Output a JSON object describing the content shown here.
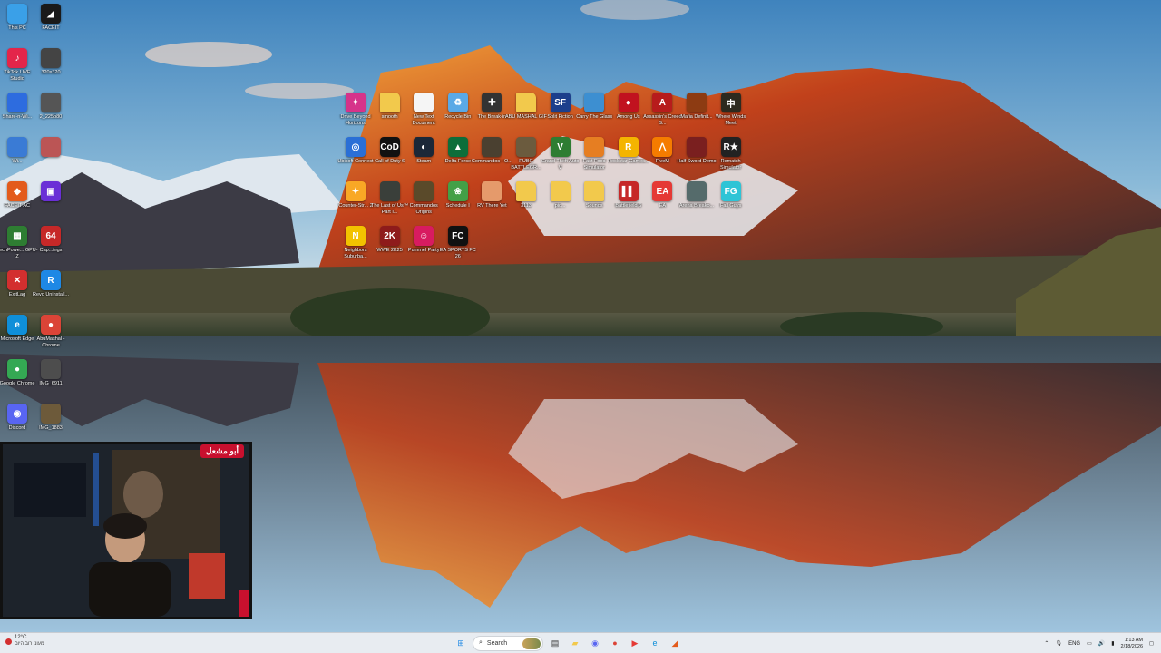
{
  "desktop": {
    "left_column": [
      {
        "label": "This PC",
        "icon": "monitor-icon",
        "color": "#3aa0e8",
        "glyph": ""
      },
      {
        "label": "FACEIT",
        "icon": "faceit-icon",
        "color": "#1a1a1a",
        "glyph": "◢"
      },
      {
        "label": "TikTok LIVE Studio",
        "icon": "tiktok-icon",
        "color": "#e4254a",
        "glyph": "♪"
      },
      {
        "label": "320x320",
        "icon": "image-file-icon",
        "color": "#444",
        "glyph": ""
      },
      {
        "label": "Share-n-Wi...",
        "icon": "app-icon",
        "color": "#2d6cdf",
        "glyph": ""
      },
      {
        "label": "2_225b80",
        "icon": "image-file-icon",
        "color": "#555",
        "glyph": ""
      },
      {
        "label": "Wi...",
        "icon": "app-icon",
        "color": "#3a7bd5",
        "glyph": ""
      },
      {
        "label": "",
        "icon": "image-file-icon",
        "color": "#b55",
        "glyph": ""
      },
      {
        "label": "FACEIT AC",
        "icon": "faceit-ac-icon",
        "color": "#e35b1c",
        "glyph": "◆"
      },
      {
        "label": "",
        "icon": "app-icon",
        "color": "#6a2fd6",
        "glyph": "▣"
      },
      {
        "label": "TechPowe... GPU-Z",
        "icon": "gpuz-icon",
        "color": "#2e7d32",
        "glyph": "▦"
      },
      {
        "label": "Cap...ings",
        "icon": "capframe-icon",
        "color": "#c62828",
        "glyph": "64"
      },
      {
        "label": "ExitLag",
        "icon": "exitlag-icon",
        "color": "#d32f2f",
        "glyph": "✕"
      },
      {
        "label": "Revo Uninstall...",
        "icon": "revo-icon",
        "color": "#1e88e5",
        "glyph": "R"
      },
      {
        "label": "Microsoft Edge",
        "icon": "edge-icon",
        "color": "#0f8fd9",
        "glyph": "e"
      },
      {
        "label": "AbuMashal - Chrome",
        "icon": "chrome-icon",
        "color": "#db4437",
        "glyph": "●"
      },
      {
        "label": "Google Chrome",
        "icon": "chrome-icon",
        "color": "#34a853",
        "glyph": "●"
      },
      {
        "label": "IMG_6911",
        "icon": "image-file-icon",
        "color": "#4d4d4d",
        "glyph": ""
      },
      {
        "label": "Discord",
        "icon": "discord-icon",
        "color": "#5865f2",
        "glyph": "◉"
      },
      {
        "label": "IMG_1883",
        "icon": "image-file-icon",
        "color": "#6d5a3a",
        "glyph": ""
      }
    ],
    "grid": [
      {
        "label": "Drive Beyond Horizons",
        "icon": "game-icon",
        "color": "#d6338a",
        "glyph": "✦"
      },
      {
        "label": "smooth",
        "icon": "folder-icon",
        "color": "#f2c94c",
        "glyph": ""
      },
      {
        "label": "New Text Document",
        "icon": "text-file-icon",
        "color": "#f5f5f5",
        "glyph": ""
      },
      {
        "label": "Recycle Bin",
        "icon": "recycle-bin-icon",
        "color": "#5aa9e6",
        "glyph": "♻"
      },
      {
        "label": "The Break-in",
        "icon": "game-icon",
        "color": "#333",
        "glyph": "✚"
      },
      {
        "label": "ABU MASHAL GIF",
        "icon": "folder-icon",
        "color": "#f2c94c",
        "glyph": ""
      },
      {
        "label": "Split Fiction",
        "icon": "game-icon",
        "color": "#1c3f8c",
        "glyph": "SF"
      },
      {
        "label": "Carry The Glass",
        "icon": "game-icon",
        "color": "#3d8fd1",
        "glyph": ""
      },
      {
        "label": "Among Us",
        "icon": "game-icon",
        "color": "#c1121f",
        "glyph": "●"
      },
      {
        "label": "Assassin's Creed S...",
        "icon": "game-icon",
        "color": "#b71c1c",
        "glyph": "A"
      },
      {
        "label": "Mafia Definit...",
        "icon": "game-icon",
        "color": "#8d3b12",
        "glyph": ""
      },
      {
        "label": "Where Winds Meet",
        "icon": "game-icon",
        "color": "#2d2a1f",
        "glyph": "中"
      },
      {
        "label": "Ubisoft Connect",
        "icon": "ubisoft-icon",
        "color": "#2a6fd6",
        "glyph": "◎"
      },
      {
        "label": "Call of Duty 6",
        "icon": "game-icon",
        "color": "#111",
        "glyph": "CoD"
      },
      {
        "label": "Steam",
        "icon": "steam-icon",
        "color": "#1b2838",
        "glyph": "◐"
      },
      {
        "label": "Delta Force",
        "icon": "game-icon",
        "color": "#0d6e3a",
        "glyph": "▲"
      },
      {
        "label": "Commandos - O...",
        "icon": "game-icon",
        "color": "#4a4030",
        "glyph": ""
      },
      {
        "label": "PUBG BATTLEGR...",
        "icon": "game-icon",
        "color": "#6b5b3e",
        "glyph": ""
      },
      {
        "label": "Grand Theft Auto V",
        "icon": "game-icon",
        "color": "#2e7d32",
        "glyph": "V"
      },
      {
        "label": "Fast Food Simulator",
        "icon": "game-icon",
        "color": "#e67e22",
        "glyph": ""
      },
      {
        "label": "Rockstar Games...",
        "icon": "rockstar-icon",
        "color": "#f4b400",
        "glyph": "R"
      },
      {
        "label": "FiveM",
        "icon": "fivem-icon",
        "color": "#f57c00",
        "glyph": "⋀"
      },
      {
        "label": "Half Sword Demo",
        "icon": "game-icon",
        "color": "#7a1f1f",
        "glyph": ""
      },
      {
        "label": "Rematch Simulator",
        "icon": "game-icon",
        "color": "#222",
        "glyph": "R★"
      },
      {
        "label": "Counter-Str... 2",
        "icon": "cs2-icon",
        "color": "#f9a825",
        "glyph": "✦"
      },
      {
        "label": "The Last of Us™ Part I...",
        "icon": "game-icon",
        "color": "#3a3f3a",
        "glyph": ""
      },
      {
        "label": "Commandos Origins",
        "icon": "game-icon",
        "color": "#5a4a2a",
        "glyph": ""
      },
      {
        "label": "Schedule I",
        "icon": "game-icon",
        "color": "#43a047",
        "glyph": "❀"
      },
      {
        "label": "RV There Yet",
        "icon": "game-icon",
        "color": "#e59a6b",
        "glyph": ""
      },
      {
        "label": "3113",
        "icon": "folder-icon",
        "color": "#f2c94c",
        "glyph": ""
      },
      {
        "label": "pic...",
        "icon": "folder-icon",
        "color": "#f2c94c",
        "glyph": ""
      },
      {
        "label": "Sounds",
        "icon": "folder-icon",
        "color": "#f2c94c",
        "glyph": ""
      },
      {
        "label": "Battlefield 6",
        "icon": "game-icon",
        "color": "#c62828",
        "glyph": "▌▌"
      },
      {
        "label": "EA",
        "icon": "ea-icon",
        "color": "#e53935",
        "glyph": "EA"
      },
      {
        "label": "Arena Breako...",
        "icon": "game-icon",
        "color": "#556b6b",
        "glyph": ""
      },
      {
        "label": "Fall Guys",
        "icon": "game-icon",
        "color": "#2ec4d6",
        "glyph": "FG"
      },
      {
        "label": "Neighbors Suburba...",
        "icon": "game-icon",
        "color": "#f2c200",
        "glyph": "N"
      },
      {
        "label": "WWE 2K25",
        "icon": "game-icon",
        "color": "#8e1b1b",
        "glyph": "2K"
      },
      {
        "label": "Pummel Party",
        "icon": "game-icon",
        "color": "#d81b60",
        "glyph": "☺"
      },
      {
        "label": "EA SPORTS FC 26",
        "icon": "game-icon",
        "color": "#111",
        "glyph": "FC"
      }
    ]
  },
  "webcam": {
    "badge": "أبو مشعل"
  },
  "taskbar": {
    "weather_temp": "12°C",
    "weather_sub": "מעונן רוב היום",
    "search_placeholder": "Search",
    "language": "ENG",
    "time": "1:13 AM",
    "date": "2/18/2026",
    "apps": [
      {
        "name": "start-button-icon",
        "glyph": "⊞",
        "color": "#1e88e5"
      },
      {
        "name": "task-view-icon",
        "glyph": "▤",
        "color": "#333"
      },
      {
        "name": "file-explorer-icon",
        "glyph": "▰",
        "color": "#f2c94c"
      },
      {
        "name": "discord-icon",
        "glyph": "◉",
        "color": "#5865f2"
      },
      {
        "name": "chrome-icon",
        "glyph": "●",
        "color": "#db4437"
      },
      {
        "name": "youtube-icon",
        "glyph": "▶",
        "color": "#e53935"
      },
      {
        "name": "edge-icon",
        "glyph": "e",
        "color": "#0f8fd9"
      },
      {
        "name": "faceit-icon",
        "glyph": "◢",
        "color": "#e35b1c"
      }
    ]
  }
}
